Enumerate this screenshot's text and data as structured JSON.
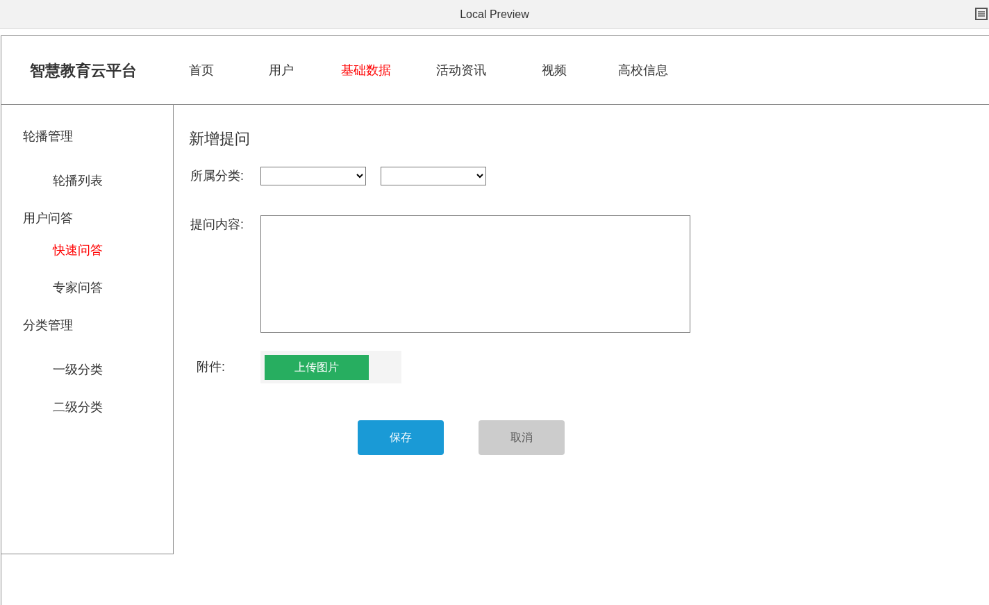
{
  "window": {
    "title": "Local Preview"
  },
  "header": {
    "logo": "智慧教育云平台",
    "nav": [
      {
        "label": "首页",
        "selected": false
      },
      {
        "label": "用户",
        "selected": false
      },
      {
        "label": "基础数据",
        "selected": true
      },
      {
        "label": "活动资讯",
        "selected": false
      },
      {
        "label": "视频",
        "selected": false
      },
      {
        "label": "高校信息",
        "selected": false
      }
    ]
  },
  "sidebar": {
    "groups": [
      {
        "label": "轮播管理",
        "children": [
          {
            "label": "轮播列表",
            "selected": false
          }
        ]
      },
      {
        "label": "用户问答",
        "children": [
          {
            "label": "快速问答",
            "selected": true
          },
          {
            "label": "专家问答",
            "selected": false
          }
        ]
      },
      {
        "label": "分类管理",
        "children": [
          {
            "label": "一级分类",
            "selected": false
          },
          {
            "label": "二级分类",
            "selected": false
          }
        ]
      }
    ]
  },
  "form": {
    "title": "新增提问",
    "category_label": "所属分类:",
    "content_label": "提问内容:",
    "attachment_label": "附件:",
    "upload_button": "上传图片",
    "buttons": [
      {
        "label": "保存",
        "kind": "primary"
      },
      {
        "label": "取消",
        "kind": "cancel"
      }
    ]
  }
}
